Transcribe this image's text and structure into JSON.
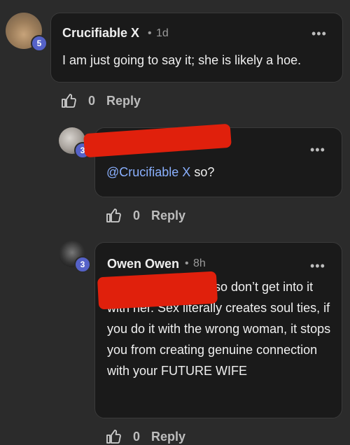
{
  "comments": [
    {
      "author": "Crucifiable X",
      "time": "1d",
      "badge": "5",
      "text": "I am just going to say it; she is likely a hoe.",
      "likes": "0",
      "reply": "Reply"
    },
    {
      "author": "",
      "time": "",
      "badge": "3",
      "mention": "@Crucifiable X",
      "text": "so?",
      "likes": "0",
      "reply": "Reply"
    },
    {
      "author": "Owen Owen",
      "time": "8h",
      "badge": "3",
      "text_line1": "so don’t get into it",
      "text_rest": "with her. Sex literally creates soul ties, if you do it with the wrong woman, it stops you from creating genuine connection with your FUTURE WIFE",
      "likes": "0",
      "reply": "Reply"
    }
  ],
  "ui": {
    "dot": "•",
    "more_glyph": "•••"
  },
  "colors": {
    "background": "#2b2b2b",
    "bubble": "#1a1a1a",
    "badge": "#5562c8",
    "mention": "#8ab0ff",
    "redaction": "#e0200c"
  }
}
